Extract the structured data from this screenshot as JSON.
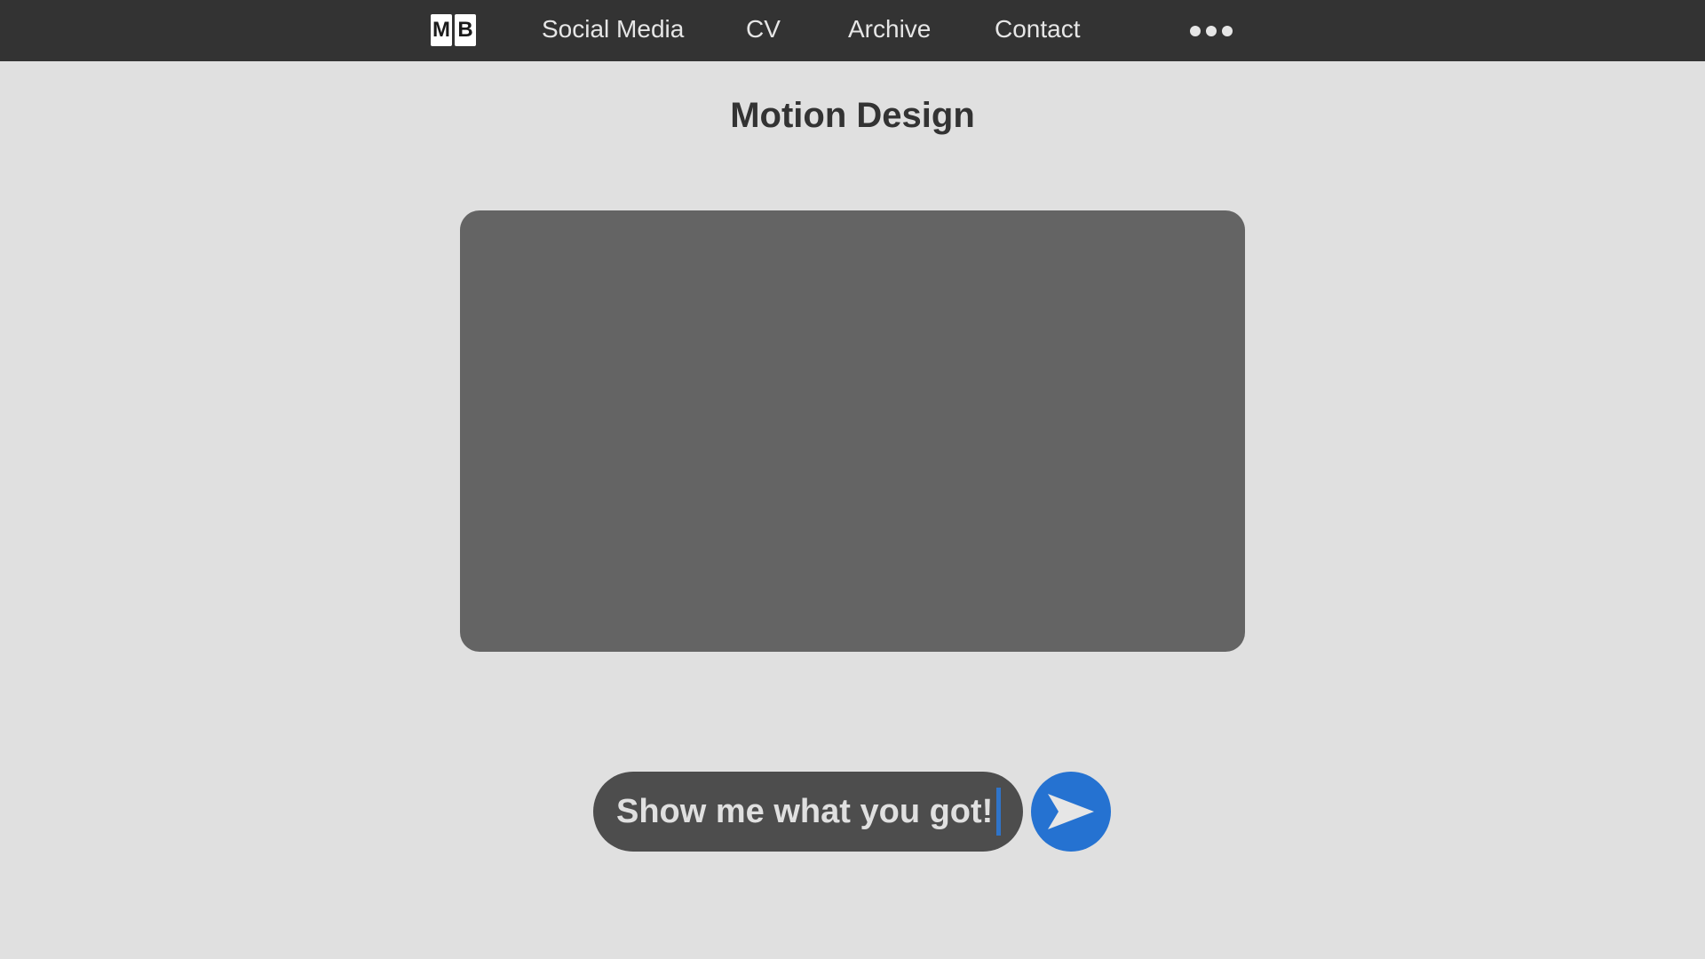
{
  "logo": {
    "letters": [
      "M",
      "B"
    ]
  },
  "nav": {
    "items": [
      {
        "label": "Social Media"
      },
      {
        "label": "CV"
      },
      {
        "label": "Archive"
      },
      {
        "label": "Contact"
      }
    ],
    "more_icon": "ellipsis-icon"
  },
  "page": {
    "title": "Motion Design"
  },
  "media": {
    "panel_color": "#646464"
  },
  "chat": {
    "value": "Show me what you got!",
    "send_icon": "send-arrow-icon",
    "accent_color": "#2572d1"
  }
}
